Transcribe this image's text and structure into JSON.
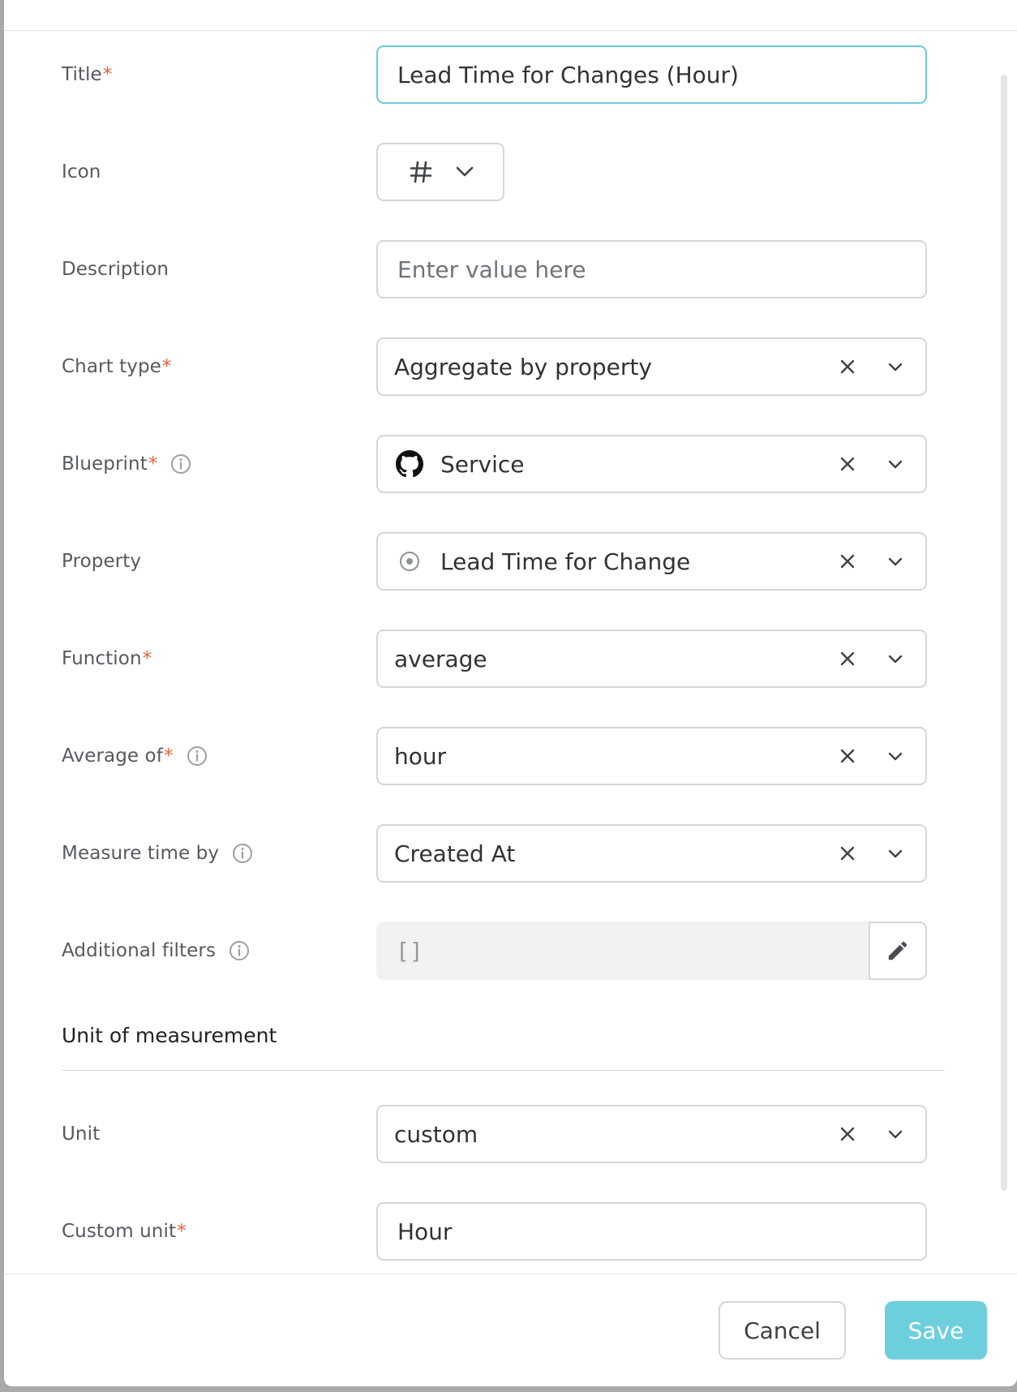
{
  "form": {
    "title": {
      "label": "Title",
      "value": "Lead Time for Changes (Hour)",
      "required": "*"
    },
    "icon": {
      "label": "Icon",
      "selected_icon": "hash-icon"
    },
    "description": {
      "label": "Description",
      "placeholder": "Enter value here"
    },
    "chart_type": {
      "label": "Chart type",
      "required": "*",
      "value": "Aggregate by property"
    },
    "blueprint": {
      "label": "Blueprint",
      "required": "*",
      "value": "Service",
      "icon": "github-icon"
    },
    "property": {
      "label": "Property",
      "value": "Lead Time for Change",
      "icon": "radio-dot-icon"
    },
    "function": {
      "label": "Function",
      "required": "*",
      "value": "average"
    },
    "average_of": {
      "label": "Average of",
      "required": "*",
      "value": "hour"
    },
    "measure_time_by": {
      "label": "Measure time by",
      "value": "Created At"
    },
    "additional_filters": {
      "label": "Additional filters",
      "value": "[]"
    },
    "unit_section": {
      "title": "Unit of measurement"
    },
    "unit": {
      "label": "Unit",
      "value": "custom"
    },
    "custom_unit": {
      "label": "Custom unit",
      "required": "*",
      "value": "Hour"
    }
  },
  "footer": {
    "cancel_label": "Cancel",
    "save_label": "Save"
  },
  "colors": {
    "accent": "#6ecfdc",
    "focus_border": "#6ccad8",
    "required": "#e8623a"
  }
}
